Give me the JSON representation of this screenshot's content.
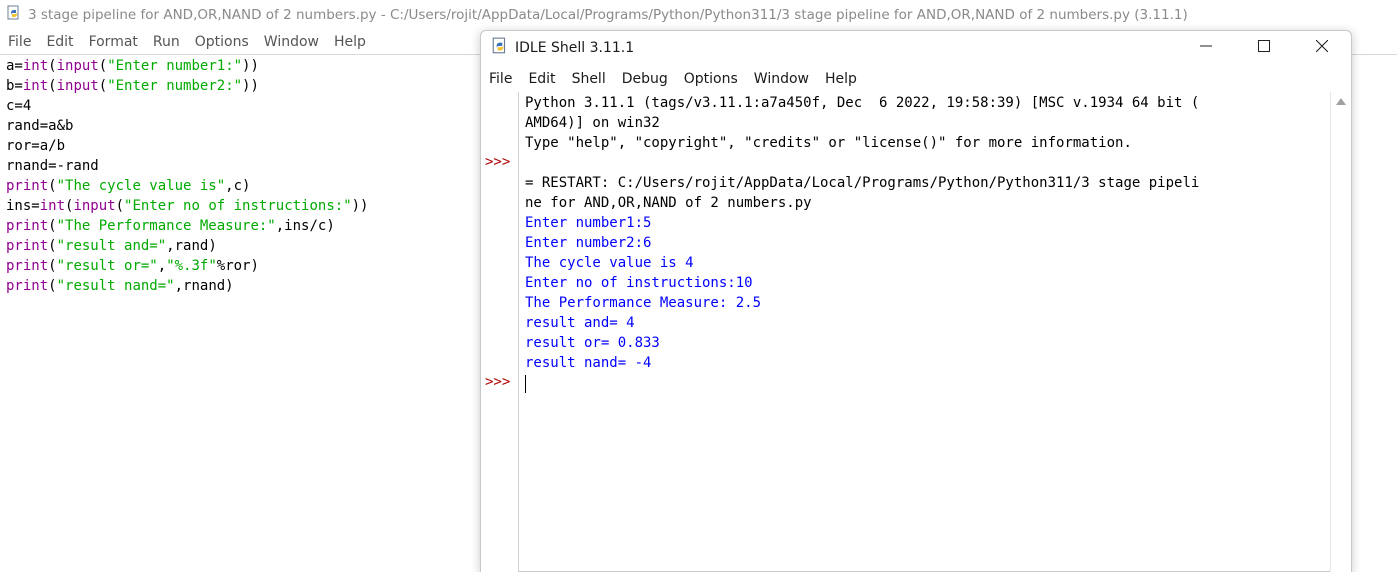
{
  "editor": {
    "title": "3 stage pipeline for AND,OR,NAND of 2 numbers.py - C:/Users/rojit/AppData/Local/Programs/Python/Python311/3 stage pipeline for AND,OR,NAND of 2 numbers.py (3.11.1)",
    "menu": [
      "File",
      "Edit",
      "Format",
      "Run",
      "Options",
      "Window",
      "Help"
    ],
    "code": [
      [
        {
          "t": "a=",
          "c": "txt"
        },
        {
          "t": "int",
          "c": "kw"
        },
        {
          "t": "(",
          "c": "txt"
        },
        {
          "t": "input",
          "c": "kw"
        },
        {
          "t": "(",
          "c": "txt"
        },
        {
          "t": "\"Enter number1:\"",
          "c": "str"
        },
        {
          "t": "))",
          "c": "txt"
        }
      ],
      [
        {
          "t": "b=",
          "c": "txt"
        },
        {
          "t": "int",
          "c": "kw"
        },
        {
          "t": "(",
          "c": "txt"
        },
        {
          "t": "input",
          "c": "kw"
        },
        {
          "t": "(",
          "c": "txt"
        },
        {
          "t": "\"Enter number2:\"",
          "c": "str"
        },
        {
          "t": "))",
          "c": "txt"
        }
      ],
      [
        {
          "t": "c=4",
          "c": "txt"
        }
      ],
      [
        {
          "t": "rand=a&b",
          "c": "txt"
        }
      ],
      [
        {
          "t": "ror=a/b",
          "c": "txt"
        }
      ],
      [
        {
          "t": "rnand=-rand",
          "c": "txt"
        }
      ],
      [
        {
          "t": "print",
          "c": "kw"
        },
        {
          "t": "(",
          "c": "txt"
        },
        {
          "t": "\"The cycle value is\"",
          "c": "str"
        },
        {
          "t": ",c)",
          "c": "txt"
        }
      ],
      [
        {
          "t": "ins=",
          "c": "txt"
        },
        {
          "t": "int",
          "c": "kw"
        },
        {
          "t": "(",
          "c": "txt"
        },
        {
          "t": "input",
          "c": "kw"
        },
        {
          "t": "(",
          "c": "txt"
        },
        {
          "t": "\"Enter no of instructions:\"",
          "c": "str"
        },
        {
          "t": "))",
          "c": "txt"
        }
      ],
      [
        {
          "t": "print",
          "c": "kw"
        },
        {
          "t": "(",
          "c": "txt"
        },
        {
          "t": "\"The Performance Measure:\"",
          "c": "str"
        },
        {
          "t": ",ins/c)",
          "c": "txt"
        }
      ],
      [
        {
          "t": "print",
          "c": "kw"
        },
        {
          "t": "(",
          "c": "txt"
        },
        {
          "t": "\"result and=\"",
          "c": "str"
        },
        {
          "t": ",rand)",
          "c": "txt"
        }
      ],
      [
        {
          "t": "print",
          "c": "kw"
        },
        {
          "t": "(",
          "c": "txt"
        },
        {
          "t": "\"result or=\"",
          "c": "str"
        },
        {
          "t": ",",
          "c": "txt"
        },
        {
          "t": "\"%.3f\"",
          "c": "str"
        },
        {
          "t": "%ror)",
          "c": "txt"
        }
      ],
      [
        {
          "t": "print",
          "c": "kw"
        },
        {
          "t": "(",
          "c": "txt"
        },
        {
          "t": "\"result nand=\"",
          "c": "str"
        },
        {
          "t": ",rnand)",
          "c": "txt"
        }
      ]
    ]
  },
  "shell": {
    "title": "IDLE Shell 3.11.1",
    "menu": [
      "File",
      "Edit",
      "Shell",
      "Debug",
      "Options",
      "Window",
      "Help"
    ],
    "prompt": ">>>",
    "lines": [
      {
        "text": "Python 3.11.1 (tags/v3.11.1:a7a450f, Dec  6 2022, 19:58:39) [MSC v.1934 64 bit (",
        "color": "black"
      },
      {
        "text": "AMD64)] on win32",
        "color": "black"
      },
      {
        "text": "Type \"help\", \"copyright\", \"credits\" or \"license()\" for more information.",
        "color": "black"
      },
      {
        "text": "",
        "color": "black"
      },
      {
        "text": "= RESTART: C:/Users/rojit/AppData/Local/Programs/Python/Python311/3 stage pipeli",
        "color": "black"
      },
      {
        "text": "ne for AND,OR,NAND of 2 numbers.py",
        "color": "black"
      },
      {
        "text": "Enter number1:5",
        "color": "blue"
      },
      {
        "text": "Enter number2:6",
        "color": "blue"
      },
      {
        "text": "The cycle value is 4",
        "color": "blue"
      },
      {
        "text": "Enter no of instructions:10",
        "color": "blue"
      },
      {
        "text": "The Performance Measure: 2.5",
        "color": "blue"
      },
      {
        "text": "result and= 4",
        "color": "blue"
      },
      {
        "text": "result or= 0.833",
        "color": "blue"
      },
      {
        "text": "result nand= -4",
        "color": "blue"
      }
    ]
  },
  "colors": {
    "keyword": "#900090",
    "string": "#00aa00",
    "output": "#0000ff",
    "prompt": "#b00000"
  },
  "icons": {
    "app": "python-idle-icon",
    "minimize": "minimize-icon",
    "maximize": "maximize-icon",
    "close": "close-icon"
  }
}
